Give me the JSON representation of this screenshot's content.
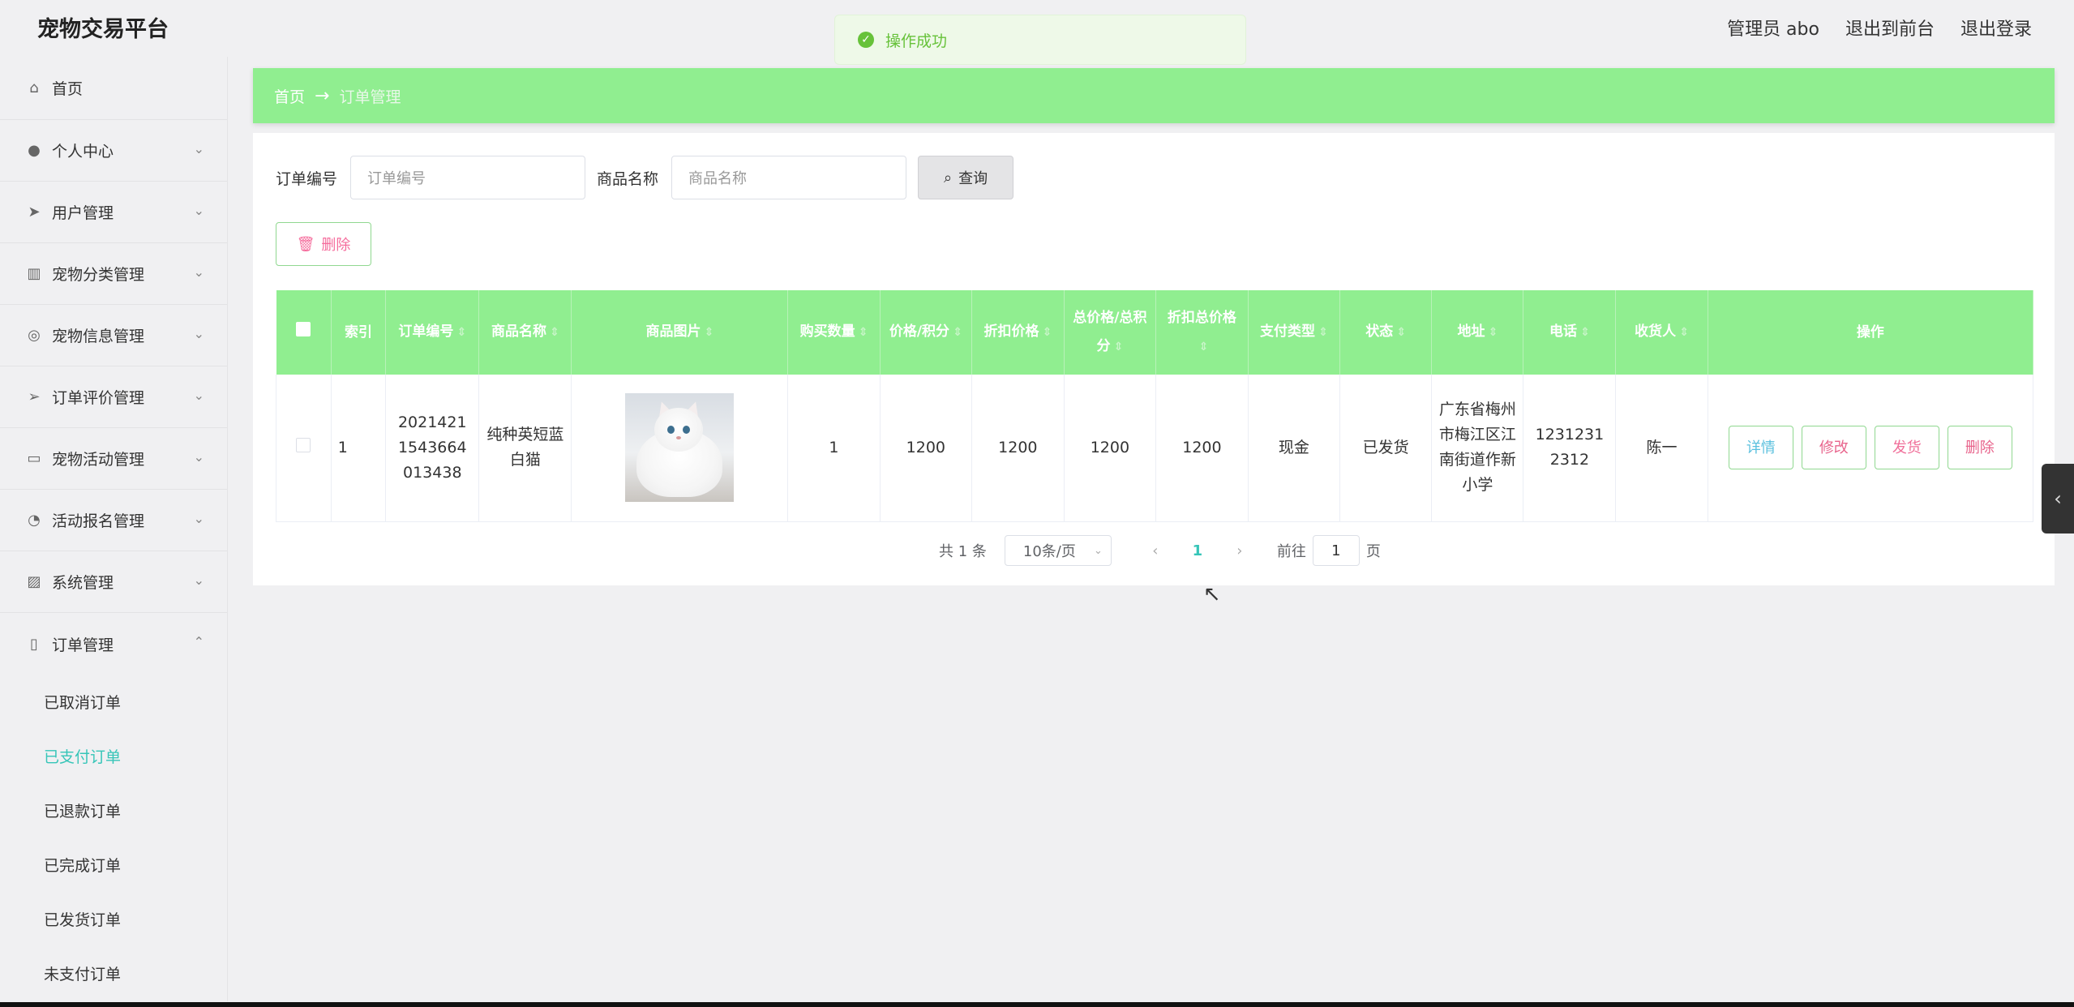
{
  "app": {
    "brand": "宠物交易平台"
  },
  "header": {
    "user": "管理员 abo",
    "to_front": "退出到前台",
    "logout": "退出登录"
  },
  "toast": {
    "message": "操作成功"
  },
  "sidebar": {
    "home": "首页",
    "items": [
      {
        "label": "个人中心",
        "icon": "user-icon"
      },
      {
        "label": "用户管理",
        "icon": "send-icon"
      },
      {
        "label": "宠物分类管理",
        "icon": "chart-icon"
      },
      {
        "label": "宠物信息管理",
        "icon": "circle-icon"
      },
      {
        "label": "订单评价管理",
        "icon": "paper-plane-icon"
      },
      {
        "label": "宠物活动管理",
        "icon": "chat-icon"
      },
      {
        "label": "活动报名管理",
        "icon": "gauge-icon"
      },
      {
        "label": "系统管理",
        "icon": "trend-icon"
      },
      {
        "label": "订单管理",
        "icon": "phone-icon"
      }
    ],
    "sub_items": [
      "已取消订单",
      "已支付订单",
      "已退款订单",
      "已完成订单",
      "已发货订单",
      "未支付订单"
    ]
  },
  "breadcrumb": {
    "home": "首页",
    "arrow": "→",
    "current": "订单管理"
  },
  "search": {
    "order_label": "订单编号",
    "order_placeholder": "订单编号",
    "goods_label": "商品名称",
    "goods_placeholder": "商品名称",
    "query_label": "查询"
  },
  "toolbar": {
    "delete_label": "删除"
  },
  "table": {
    "headers": [
      "索引",
      "订单编号",
      "商品名称",
      "商品图片",
      "购买数量",
      "价格/积分",
      "折扣价格",
      "总价格/总积分",
      "折扣总价格",
      "支付类型",
      "状态",
      "地址",
      "电话",
      "收货人",
      "操作"
    ],
    "row": {
      "index": "1",
      "order_no": "2021421 1543664 013438",
      "goods_name": "纯种英短蓝白猫",
      "quantity": "1",
      "price": "1200",
      "discount_price": "1200",
      "total": "1200",
      "discount_total": "1200",
      "pay_type": "现金",
      "status": "已发货",
      "address": "广东省梅州市梅江区江南街道作新小学",
      "phone": "1231231 2312",
      "receiver": "陈一"
    },
    "actions": {
      "detail": "详情",
      "edit": "修改",
      "ship": "发货",
      "delete": "删除"
    }
  },
  "pagination": {
    "total": "共 1 条",
    "page_size": "10条/页",
    "current": "1",
    "goto": "前往",
    "goto_value": "1",
    "page_unit": "页"
  },
  "colors": {
    "accent": "#90ee90",
    "active": "#36c5b8",
    "danger": "#e8648c"
  }
}
